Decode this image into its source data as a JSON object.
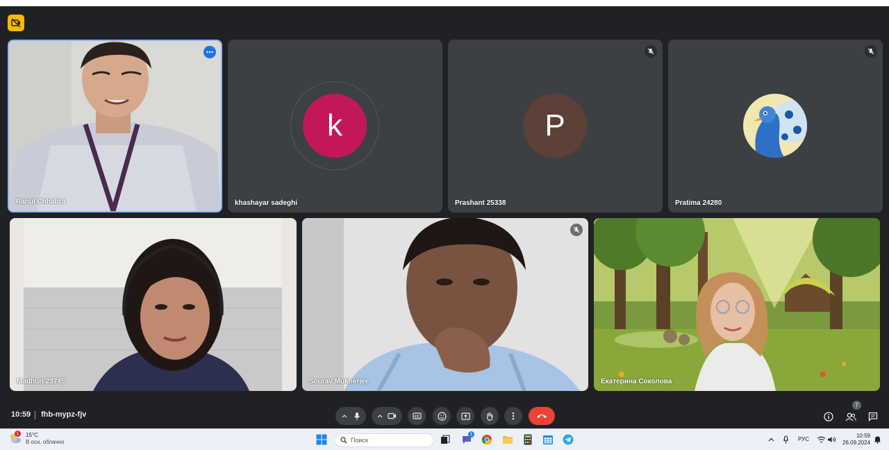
{
  "meeting": {
    "time": "10:59",
    "code": "fhb-mypz-fjv",
    "participants_count": "7"
  },
  "participants": [
    {
      "name": "Rahul Chhabra",
      "type": "video"
    },
    {
      "name": "khashayar sadeghi",
      "type": "avatar",
      "initial": "k",
      "color": "#c2185b"
    },
    {
      "name": "Prashant 25338",
      "type": "avatar",
      "initial": "P",
      "color": "#5d4037"
    },
    {
      "name": "Pratima 24280",
      "type": "avatar-image"
    },
    {
      "name": "Madhuri 23745",
      "type": "video"
    },
    {
      "name": "Sourav Mukherjee",
      "type": "video"
    },
    {
      "name": "Екатерина Соколова",
      "type": "video"
    }
  ],
  "taskbar": {
    "weather_temp": "15°C",
    "weather_desc": "В осн. облачно",
    "weather_badge": "1",
    "search_placeholder": "Поиск",
    "lang": "РУС",
    "clock_time": "10:59",
    "clock_date": "26.09.2024",
    "chat_badge": "1"
  },
  "colors": {
    "meet_bg": "#202124",
    "tile_bg": "#3c4043",
    "active_border": "#8ab4f8",
    "end_call": "#ea4335",
    "badge_yellow": "#f9ba00"
  }
}
